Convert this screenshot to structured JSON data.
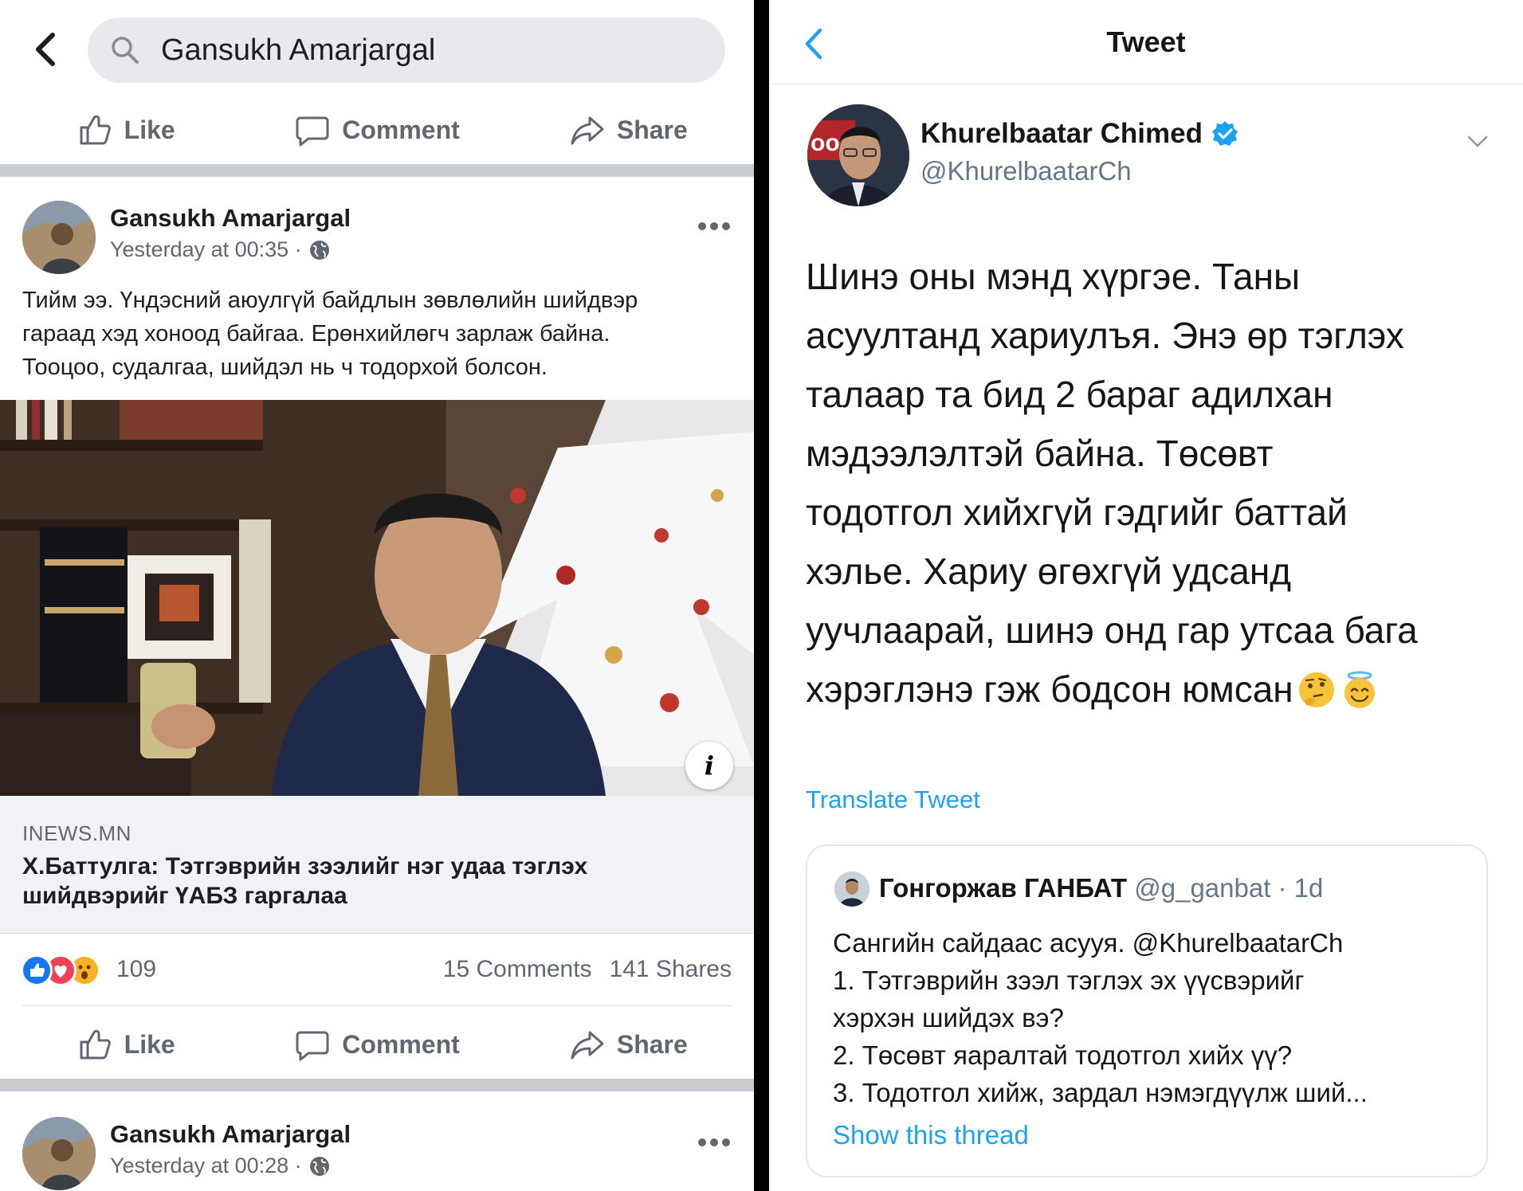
{
  "facebook": {
    "search": {
      "query": "Gansukh Amarjargal"
    },
    "actions": {
      "like": "Like",
      "comment": "Comment",
      "share": "Share"
    },
    "post": {
      "author": "Gansukh Amarjargal",
      "time": "Yesterday at 00:35 ·",
      "text_lines": [
        "Тийм ээ. Үндэсний аюулгүй байдлын зөвлөлийн шийдвэр",
        "гараад хэд хоноод байгаа. Ерөнхийлөгч зарлаж байна.",
        "Тооцоо, судалгаа, шийдэл нь ч тодорхой болсон."
      ],
      "link": {
        "domain": "INEWS.MN",
        "title_lines": [
          "Х.Баттулга: Тэтгэврийн зээлийг нэг удаа тэглэх",
          "шийдвэрийг ҮАБЗ гаргалаа"
        ]
      },
      "reactions_count": "109",
      "comments": "15 Comments",
      "shares": "141 Shares"
    },
    "next_post": {
      "author": "Gansukh Amarjargal",
      "time": "Yesterday at 00:28 ·"
    },
    "colors": {
      "like_blue": "#1877f2",
      "love_red": "#f33e58",
      "wow_yellow": "#f7b125"
    }
  },
  "twitter": {
    "header_title": "Tweet",
    "author_name": "Khurelbaatar Chimed",
    "author_handle": "@KhurelbaatarCh",
    "text_lines": [
      "Шинэ оны мэнд хүргэе. Таны",
      "асуултанд хариулъя. Энэ өр тэглэх",
      "талаар та бид 2 бараг адилхан",
      "мэдээлэлтэй байна. Төсөвт",
      "тодотгол хийхгүй гэдгийг баттай",
      "хэлье. Хариу өгөхгүй удсанд",
      "уучлаарай, шинэ онд гар утсаа бага",
      "хэрэглэнэ гэж бодсон юмсан"
    ],
    "emojis": [
      "thinking-face-icon",
      "smiling-face-with-halo-icon"
    ],
    "translate": "Translate Tweet",
    "quote": {
      "name": "Гонгоржав ГАНБАТ",
      "handle": "@g_ganbat",
      "age": "· 1d",
      "lines": [
        "Сангийн сайдаас асууя. @KhurelbaatarCh",
        "1. Тэтгэврийн зээл тэглэх эх үүсвэрийг",
        "хэрхэн шийдэх вэ?",
        "2. Төсөвт яаралтай тодотгол хийх үү?",
        "3. Тодотгол хийж, зардал нэмэгдүүлж ший..."
      ],
      "show_thread": "Show this thread"
    },
    "colors": {
      "link_blue": "#1da1f2",
      "verified_blue": "#1da1f2"
    }
  }
}
